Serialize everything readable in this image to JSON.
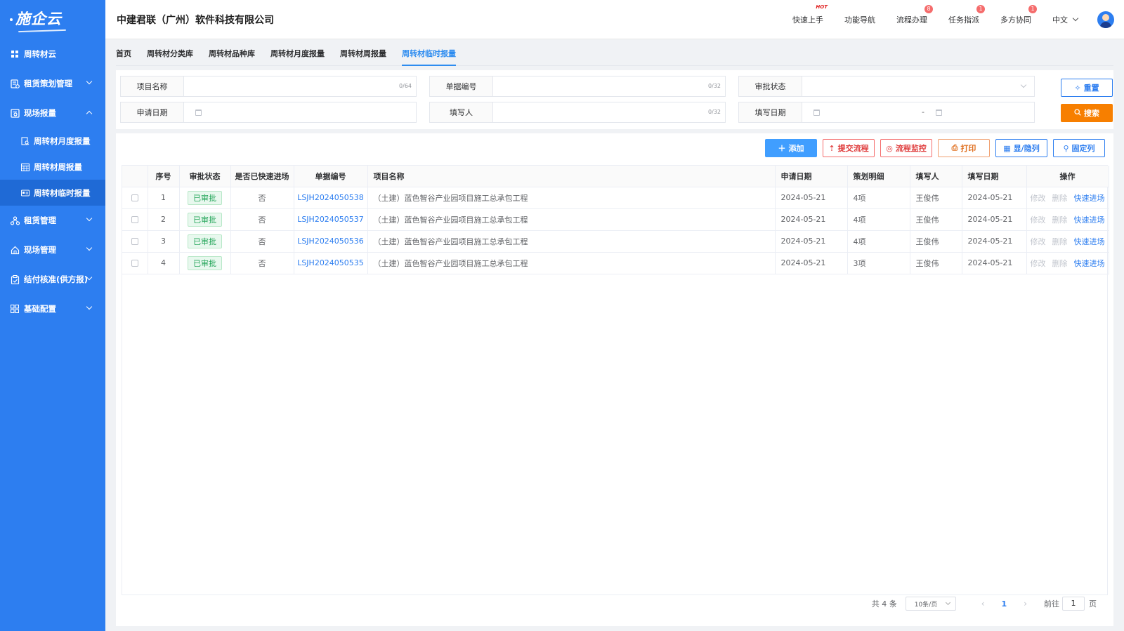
{
  "app": {
    "logo": "施企云",
    "company": "中建君联（广州）软件科技有限公司"
  },
  "sidebar": {
    "items": [
      {
        "label": "周转材云",
        "icon": "grid-icon",
        "chevron": "none"
      },
      {
        "label": "租赁策划管理",
        "icon": "plan-icon",
        "chevron": "down"
      },
      {
        "label": "现场报量",
        "icon": "report-icon",
        "chevron": "up"
      },
      {
        "label": "周转材月度报量",
        "icon": "doc-search-icon",
        "sub": true
      },
      {
        "label": "周转材周报量",
        "icon": "calendar-icon",
        "sub": true
      },
      {
        "label": "周转材临时报量",
        "icon": "card-icon",
        "sub": true,
        "active": true
      },
      {
        "label": "租赁管理",
        "icon": "org-icon",
        "chevron": "down"
      },
      {
        "label": "现场管理",
        "icon": "home-icon",
        "chevron": "down"
      },
      {
        "label": "结付核准(供方报)",
        "icon": "clipboard-icon",
        "chevron": "down"
      },
      {
        "label": "基础配置",
        "icon": "apps-icon",
        "chevron": "down"
      }
    ]
  },
  "header": {
    "nav": [
      {
        "label": "快速上手",
        "badge": "HOT",
        "type": "hot"
      },
      {
        "label": "功能导航",
        "badge": ""
      },
      {
        "label": "流程办理",
        "badge": "8"
      },
      {
        "label": "任务指派",
        "badge": "1"
      },
      {
        "label": "多方协同",
        "badge": "1"
      }
    ],
    "language": "中文"
  },
  "tabs": [
    "首页",
    "周转材分类库",
    "周转材品种库",
    "周转材月度报量",
    "周转材周报量",
    "周转材临时报量"
  ],
  "active_tab": 5,
  "filters": {
    "project_name": {
      "label": "项目名称",
      "count": "0/64"
    },
    "doc_no": {
      "label": "单据编号",
      "count": "0/32"
    },
    "approval_status": {
      "label": "审批状态"
    },
    "apply_date": {
      "label": "申请日期"
    },
    "filler": {
      "label": "填写人",
      "count": "0/32"
    },
    "fill_date": {
      "label": "填写日期",
      "separator": "-"
    },
    "reset_label": "重置",
    "search_label": "搜索"
  },
  "toolbar": {
    "add": "添加",
    "submit_flow": "提交流程",
    "monitor_flow": "流程监控",
    "print": "打印",
    "toggle_columns": "显/隐列",
    "fix_columns": "固定列"
  },
  "table": {
    "headers": [
      "",
      "序号",
      "审批状态",
      "是否已快速进场",
      "单据编号",
      "项目名称",
      "申请日期",
      "策划明细",
      "填写人",
      "填写日期",
      "操作"
    ],
    "rows": [
      {
        "no": "1",
        "status": "已审批",
        "quick": "否",
        "doc": "LSJH2024050538",
        "project": "（土建）蓝色智谷产业园项目施工总承包工程",
        "apply_date": "2024-05-21",
        "detail": "4项",
        "filler": "王俊伟",
        "fill_date": "2024-05-21"
      },
      {
        "no": "2",
        "status": "已审批",
        "quick": "否",
        "doc": "LSJH2024050537",
        "project": "（土建）蓝色智谷产业园项目施工总承包工程",
        "apply_date": "2024-05-21",
        "detail": "4项",
        "filler": "王俊伟",
        "fill_date": "2024-05-21"
      },
      {
        "no": "3",
        "status": "已审批",
        "quick": "否",
        "doc": "LSJH2024050536",
        "project": "（土建）蓝色智谷产业园项目施工总承包工程",
        "apply_date": "2024-05-21",
        "detail": "4项",
        "filler": "王俊伟",
        "fill_date": "2024-05-21"
      },
      {
        "no": "4",
        "status": "已审批",
        "quick": "否",
        "doc": "LSJH2024050535",
        "project": "（土建）蓝色智谷产业园项目施工总承包工程",
        "apply_date": "2024-05-21",
        "detail": "3项",
        "filler": "王俊伟",
        "fill_date": "2024-05-21"
      }
    ],
    "ops": {
      "edit": "修改",
      "delete": "删除",
      "quick_entry": "快速进场"
    }
  },
  "pagination": {
    "total": "共 4 条",
    "page_size": "10条/页",
    "current": "1",
    "goto_prefix": "前往",
    "goto_value": "1",
    "goto_suffix": "页"
  },
  "colors": {
    "sidebar": "#2d7ef0",
    "primary": "#409eff",
    "search": "#f77f00",
    "danger": "#f56c6c"
  }
}
